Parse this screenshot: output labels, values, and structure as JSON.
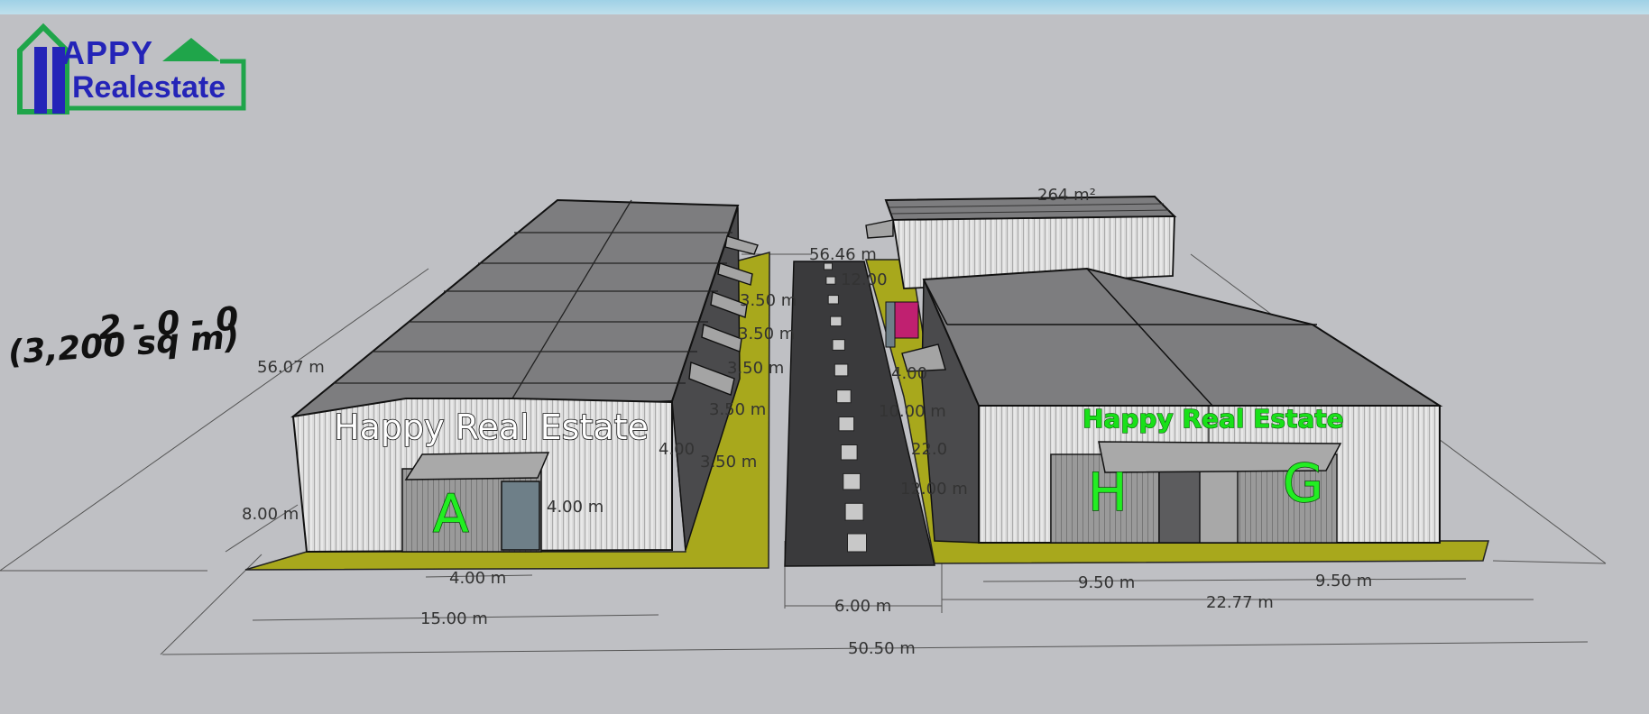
{
  "logo": {
    "top": "APPY",
    "bottom": "Realestate"
  },
  "plot": {
    "code": "2 - 0 - 0",
    "area": "(3,200 sq m)"
  },
  "facade": {
    "left": "Happy Real Estate",
    "right": "Happy Real Estate"
  },
  "units": {
    "a": "A",
    "h": "H",
    "g": "G"
  },
  "dimensions": {
    "total_width": "50.50 m",
    "left_width": "15.00 m",
    "road_width": "6.00 m",
    "right_width": "22.77 m",
    "bay_1": "9.50 m",
    "bay_2": "9.50 m",
    "door_width": "4.00 m",
    "door_height": "4.00 m",
    "wall_height": "8.00 m",
    "left_depth": "56.07 m",
    "road_depth": "56.46 m",
    "roof_area": "264 m²",
    "back_12": "12.00",
    "right_4": "4.00",
    "right_10": "10.00 m",
    "right_22": "22.0",
    "right_12": "12.00 m",
    "left_4": "4.00",
    "canopy_1": "3.50 m",
    "canopy_2": "3.50 m",
    "canopy_3": "3.50 m",
    "canopy_4": "3.50 m",
    "canopy_5": "3.50 m"
  },
  "colors": {
    "ground": "#a8a81c",
    "road": "#3a3a3c",
    "roof": "#7d7d7f",
    "wall": "#d8d8d8",
    "accent": "#c02070",
    "logo_green": "#1fa54a",
    "logo_blue": "#2424b8"
  }
}
